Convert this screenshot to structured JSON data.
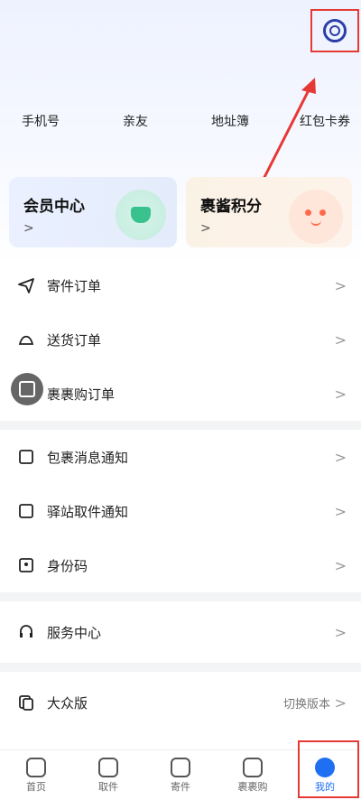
{
  "quick_links": [
    {
      "label": "手机号"
    },
    {
      "label": "亲友"
    },
    {
      "label": "地址簿"
    },
    {
      "label": "红包卡券"
    }
  ],
  "cards": {
    "vip": {
      "title": "会员中心",
      "chev": ">"
    },
    "points": {
      "title": "裹酱积分",
      "chev": ">"
    }
  },
  "menu_group1": [
    {
      "label": "寄件订单",
      "icon": "send-icon"
    },
    {
      "label": "送货订单",
      "icon": "delivery-icon"
    },
    {
      "label": "裹裹购订单",
      "icon": "shop-icon"
    }
  ],
  "menu_group2": [
    {
      "label": "包裹消息通知",
      "icon": "package-notice-icon"
    },
    {
      "label": "驿站取件通知",
      "icon": "station-icon"
    },
    {
      "label": "身份码",
      "icon": "id-code-icon"
    }
  ],
  "menu_group3": [
    {
      "label": "服务中心",
      "icon": "headset-icon"
    }
  ],
  "menu_group4": [
    {
      "label": "大众版",
      "icon": "mode-icon",
      "right_text": "切换版本"
    }
  ],
  "chevron": ">",
  "tabs": [
    {
      "label": "首页"
    },
    {
      "label": "取件"
    },
    {
      "label": "寄件"
    },
    {
      "label": "裹裹购"
    },
    {
      "label": "我的"
    }
  ],
  "colors": {
    "accent": "#1f6ff2",
    "highlight": "#e53935",
    "settings": "#2c3ea8"
  }
}
